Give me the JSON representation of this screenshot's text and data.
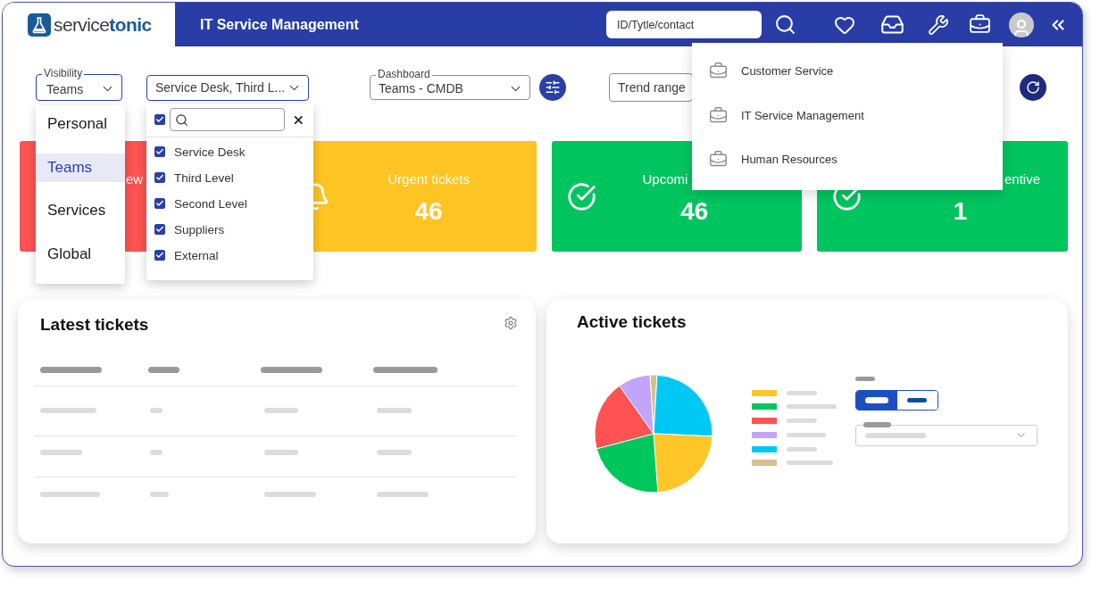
{
  "header": {
    "logo": "service**tonic**",
    "title": "IT Service Management",
    "search": {
      "placeholder": "ID/Tytle/contact"
    }
  },
  "filters": {
    "visibility": {
      "label": "Visibility",
      "value": "Teams",
      "expanded": true,
      "options": [
        {
          "label": "Personal",
          "selected": false
        },
        {
          "label": "Teams",
          "selected": true
        },
        {
          "label": "Services",
          "selected": false
        },
        {
          "label": "Global",
          "selected": false
        }
      ]
    },
    "groups": {
      "value": "Service Desk, Third L...",
      "expanded": true,
      "select_all": {
        "checked": true
      },
      "options": [
        {
          "label": "Service Desk",
          "checked": true
        },
        {
          "label": "Third Level",
          "checked": true
        },
        {
          "label": "Second Level",
          "checked": true
        },
        {
          "label": "Suppliers",
          "checked": true
        },
        {
          "label": "External",
          "checked": true
        }
      ]
    },
    "dashboard": {
      "label": "Dashboard",
      "value": "Teams - CMDB",
      "expanded": false
    },
    "trend_range": {
      "placeholder": "Trend range"
    }
  },
  "app_menu": {
    "items": [
      {
        "label": "Customer Service"
      },
      {
        "label": "IT Service Management"
      },
      {
        "label": "Human Resources"
      }
    ]
  },
  "cards": [
    {
      "kind": "new",
      "color": "#fd5353",
      "title": "ew"
    },
    {
      "kind": "urgent",
      "color": "#fec423",
      "title": "Urgent tickets",
      "count": "46"
    },
    {
      "kind": "upcoming",
      "color": "#00c55e",
      "title": "Upcomi",
      "count": "46"
    },
    {
      "kind": "upcoming",
      "color": "#00c55e",
      "title": "entive",
      "count": "1"
    }
  ],
  "latest_tickets": {
    "title": "Latest tickets"
  },
  "active_tickets": {
    "title": "Active tickets",
    "legend": [
      {
        "color": "#ffc629"
      },
      {
        "color": "#00c75c"
      },
      {
        "color": "#ff5353"
      },
      {
        "color": "#c2a5fb"
      },
      {
        "color": "#00c8f5"
      },
      {
        "color": "#d8c08f"
      }
    ],
    "view_toggle": [
      {
        "selected": true
      },
      {
        "selected": false
      }
    ]
  }
}
